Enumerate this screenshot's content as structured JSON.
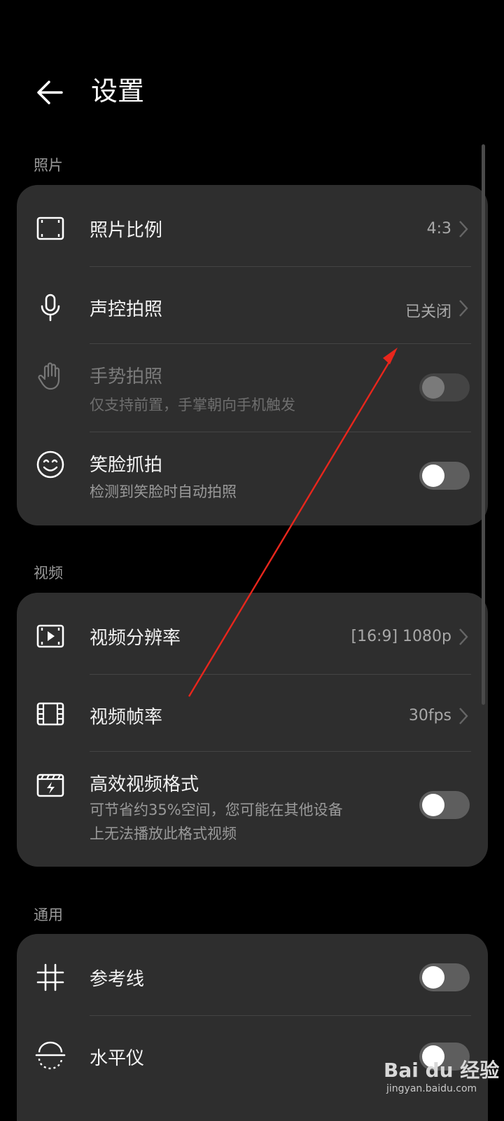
{
  "header": {
    "title": "设置",
    "back_icon": "arrow-left-icon"
  },
  "sections": {
    "photo": {
      "label": "照片",
      "items": [
        {
          "title": "照片比例",
          "value": "4:3",
          "icon": "aspect-ratio-icon"
        },
        {
          "title": "声控拍照",
          "value": "已关闭",
          "icon": "microphone-icon"
        },
        {
          "title": "手势拍照",
          "subtitle": "仅支持前置，手掌朝向手机触发",
          "icon": "hand-icon",
          "enabled": false,
          "toggle_on": false
        },
        {
          "title": "笑脸抓拍",
          "subtitle": "检测到笑脸时自动拍照",
          "icon": "smile-icon",
          "enabled": true,
          "toggle_on": false
        }
      ]
    },
    "video": {
      "label": "视频",
      "items": [
        {
          "title": "视频分辨率",
          "value": "[16:9] 1080p",
          "icon": "video-resolution-icon"
        },
        {
          "title": "视频帧率",
          "value": "30fps",
          "icon": "film-frame-icon"
        },
        {
          "title": "高效视频格式",
          "subtitle_line1": "可节省约35%空间，您可能在其他设备",
          "subtitle_line2": "上无法播放此格式视频",
          "icon": "efficient-video-icon",
          "toggle_on": false
        }
      ]
    },
    "general": {
      "label": "通用",
      "items": [
        {
          "title": "参考线",
          "icon": "grid-icon",
          "toggle_on": false
        },
        {
          "title": "水平仪",
          "icon": "level-icon",
          "toggle_on": false
        }
      ]
    }
  },
  "watermark": {
    "logo": "Bai du 经验",
    "url": "jingyan.baidu.com"
  },
  "colors": {
    "background": "#000000",
    "card": "#2e2e2e",
    "annotation_arrow": "#e8261c",
    "toggle_off": "#5e5e5e"
  }
}
